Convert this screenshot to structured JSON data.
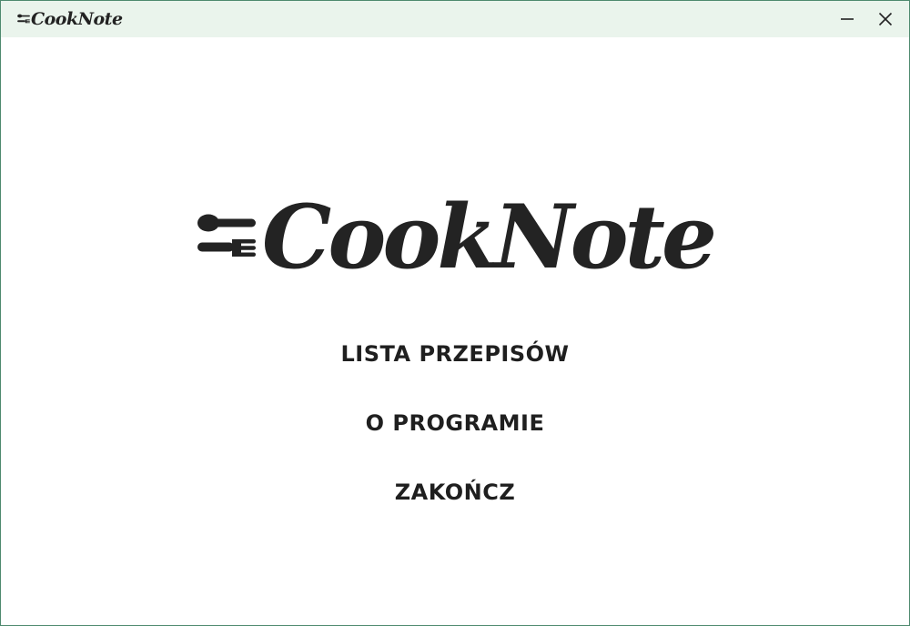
{
  "window": {
    "title": "CookNote",
    "border_color": "#4f8a6f",
    "titlebar_bg": "#eaf4ec",
    "minimize_icon": "minimize-icon",
    "close_icon": "close-icon"
  },
  "logo": {
    "text": "CookNote",
    "icon": "spoon-fork-icon"
  },
  "menu": {
    "items": [
      {
        "label": "LISTA PRZEPISÓW"
      },
      {
        "label": "O PROGRAMIE"
      },
      {
        "label": "ZAKOŃCZ"
      }
    ]
  }
}
